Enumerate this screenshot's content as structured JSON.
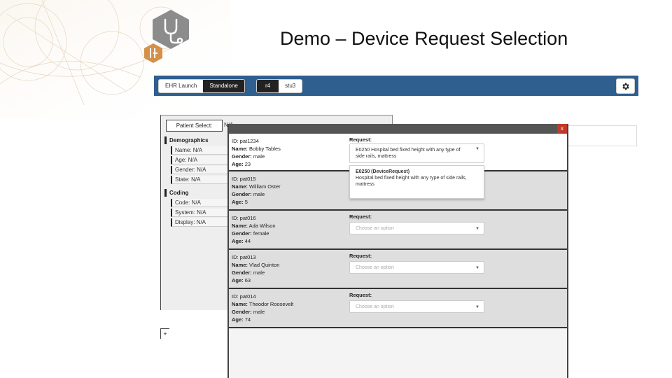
{
  "slide": {
    "title": "Demo – Device Request Selection"
  },
  "toolbar": {
    "launch_tabs": [
      "EHR Launch",
      "Standalone"
    ],
    "active_launch": "Standalone",
    "version_tabs": [
      "r4",
      "stu3"
    ],
    "active_version": "r4"
  },
  "left_panel": {
    "patient_select_label": "Patient Select:",
    "patient_value": "N/A",
    "demographics_heading": "Demographics",
    "demographics": [
      "Name: N/A",
      "Age: N/A",
      "Gender: N/A",
      "State: N/A"
    ],
    "coding_heading": "Coding",
    "coding": [
      "Code: N/A",
      "System: N/A",
      "Display: N/A"
    ],
    "add_label": "+"
  },
  "modal": {
    "close_label": "x",
    "request_label": "Request:",
    "placeholder": "Choose an option",
    "patients": [
      {
        "id": "ID: pat1234",
        "name_label": "Name:",
        "name": "Bobby Tables",
        "gender_label": "Gender:",
        "gender": "male",
        "age_label": "Age:",
        "age": "23",
        "selected": "E0250 Hospital bed fixed height with any type of side rails, mattress"
      },
      {
        "id": "ID: pat015",
        "name_label": "Name:",
        "name": "William Oster",
        "gender_label": "Gender:",
        "gender": "male",
        "age_label": "Age:",
        "age": "5"
      },
      {
        "id": "ID: pat016",
        "name_label": "Name:",
        "name": "Ada Wilson",
        "gender_label": "Gender:",
        "gender": "female",
        "age_label": "Age:",
        "age": "44"
      },
      {
        "id": "ID: pat013",
        "name_label": "Name:",
        "name": "Vlad Quinton",
        "gender_label": "Gender:",
        "gender": "male",
        "age_label": "Age:",
        "age": "63"
      },
      {
        "id": "ID: pat014",
        "name_label": "Name:",
        "name": "Theodor Roosevelt",
        "gender_label": "Gender:",
        "gender": "male",
        "age_label": "Age:",
        "age": "74"
      }
    ],
    "dropdown_option": {
      "title": "E0250 (DeviceRequest)",
      "description": "Hospital bed fixed height with any type of side rails, mattress"
    }
  },
  "colors": {
    "toolbar": "#2f5f8f",
    "modal_header": "#555555",
    "close": "#c0392b",
    "hex_icon": "#8c8c8c",
    "hex_icon_small": "#d4914a"
  },
  "icons": [
    "stethoscope-icon",
    "fhir-icon",
    "gear-icon",
    "chevron-down-icon",
    "close-icon"
  ]
}
